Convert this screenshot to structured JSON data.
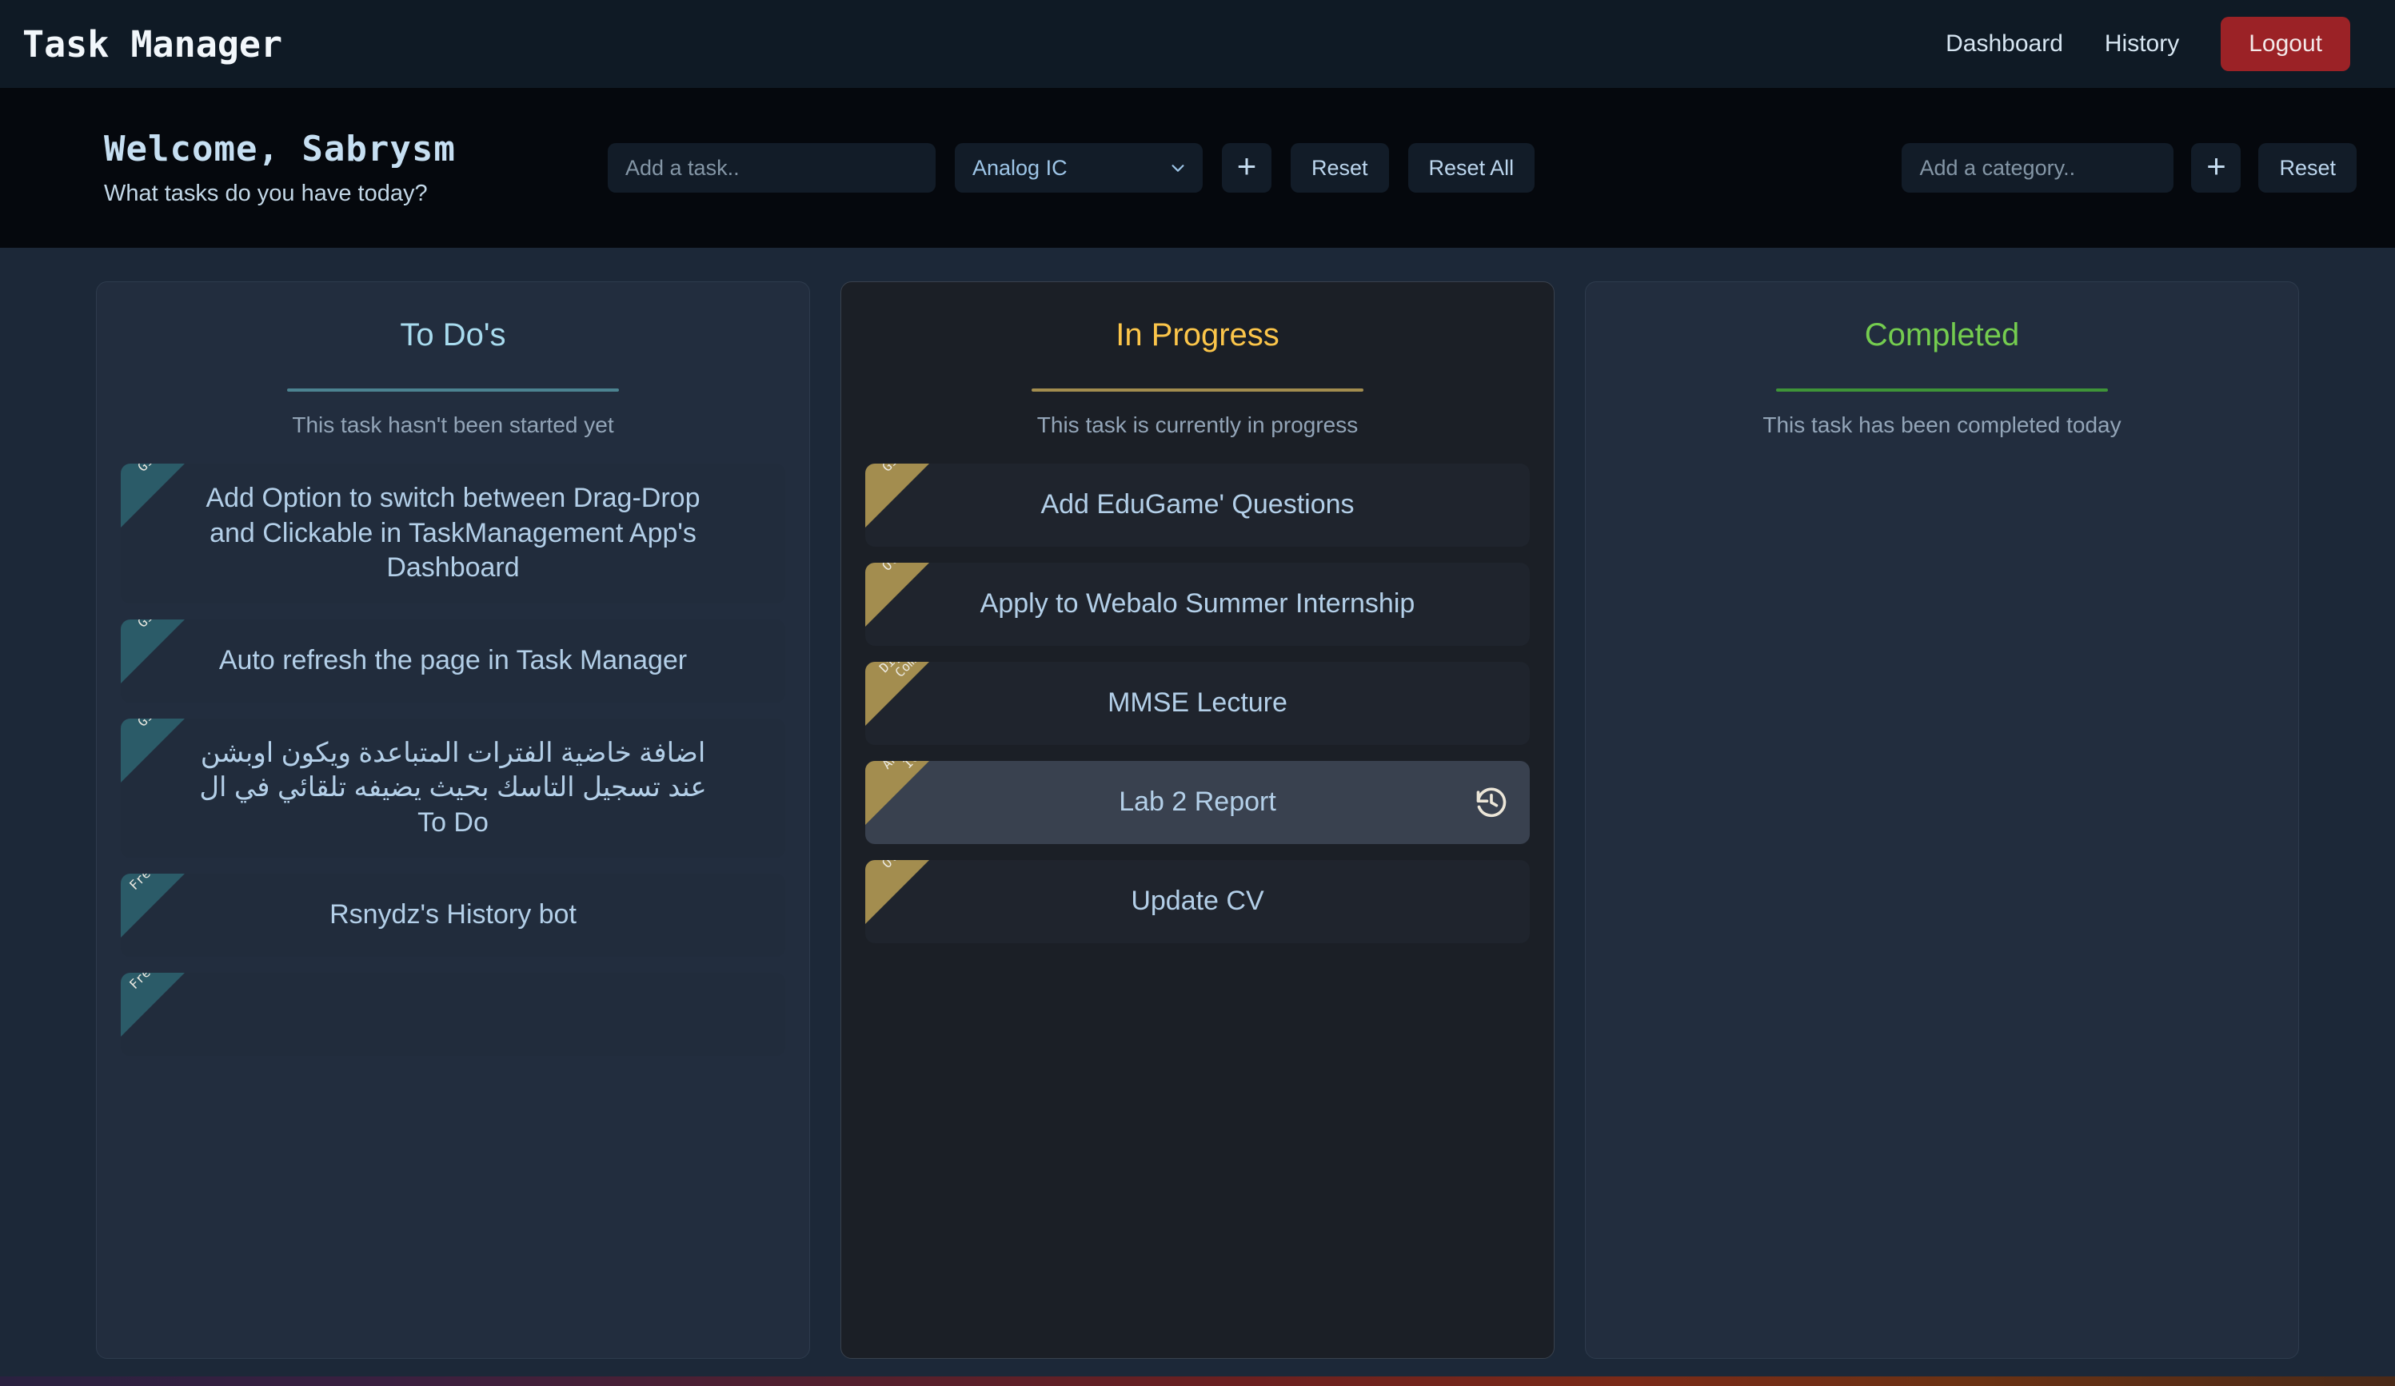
{
  "navbar": {
    "brand": "Task Manager",
    "links": [
      {
        "label": "Dashboard"
      },
      {
        "label": "History"
      }
    ],
    "logout_label": "Logout"
  },
  "header": {
    "welcome_title": "Welcome, Sabrysm",
    "welcome_subtitle": "What tasks do you have today?"
  },
  "controls": {
    "task_input_placeholder": "Add a task..",
    "task_input_value": "",
    "category_select_value": "Analog IC",
    "category_select_options": [
      "Analog IC",
      "Digital Comm.",
      "GitHub",
      "Others",
      "Freelance"
    ],
    "add_task_label": "+",
    "reset_label": "Reset",
    "reset_all_label": "Reset All",
    "category_input_placeholder": "Add a category..",
    "category_input_value": "",
    "add_category_label": "+",
    "reset_category_label": "Reset"
  },
  "colors": {
    "todo_accent": "#a8dbee",
    "todo_rule": "#4c8391",
    "progress_accent": "#fbc54a",
    "progress_rule": "#a38d4f",
    "completed_accent": "#74cc4f",
    "completed_rule": "#3f9438",
    "ribbon_todo": "#2b5b68",
    "ribbon_progress": "#a38d4f",
    "logout_bg": "#9b2226"
  },
  "columns": [
    {
      "key": "todo",
      "title": "To Do's",
      "description": "This task hasn't been started yet",
      "tasks": [
        {
          "title": "Add Option to switch between Drag-Drop and Clickable in TaskManagement App's Dashboard",
          "category": "GitHub",
          "rtl": false,
          "hovered": false,
          "action": null
        },
        {
          "title": "Auto refresh the page in Task Manager",
          "category": "GitHub",
          "rtl": false,
          "hovered": false,
          "action": null
        },
        {
          "title": "اضافة خاضية الفترات المتباعدة ويكون اوبشن عند تسجيل التاسك بحيث يضيفه تلقائي في ال To Do",
          "category": "GitHub",
          "rtl": true,
          "hovered": false,
          "action": null
        },
        {
          "title": "Rsnydz's History bot",
          "category": "Freelance",
          "rtl": false,
          "hovered": false,
          "action": null
        },
        {
          "title": "",
          "category": "Freelance",
          "rtl": false,
          "hovered": false,
          "action": null
        }
      ]
    },
    {
      "key": "in_progress",
      "title": "In Progress",
      "description": "This task is currently in progress",
      "tasks": [
        {
          "title": "Add EduGame' Questions",
          "category": "GitHub",
          "rtl": false,
          "hovered": false,
          "action": null
        },
        {
          "title": "Apply to Webalo Summer Internship",
          "category": "Others",
          "rtl": false,
          "hovered": false,
          "action": null
        },
        {
          "title": "MMSE Lecture",
          "category": "Digital\nComm.",
          "rtl": false,
          "hovered": false,
          "action": null
        },
        {
          "title": "Lab 2 Report",
          "category": "Analog\nIC",
          "rtl": false,
          "hovered": true,
          "action": "history-icon"
        },
        {
          "title": "Update CV",
          "category": "Others",
          "rtl": false,
          "hovered": false,
          "action": null
        }
      ]
    },
    {
      "key": "completed",
      "title": "Completed",
      "description": "This task has been completed today",
      "tasks": []
    }
  ]
}
